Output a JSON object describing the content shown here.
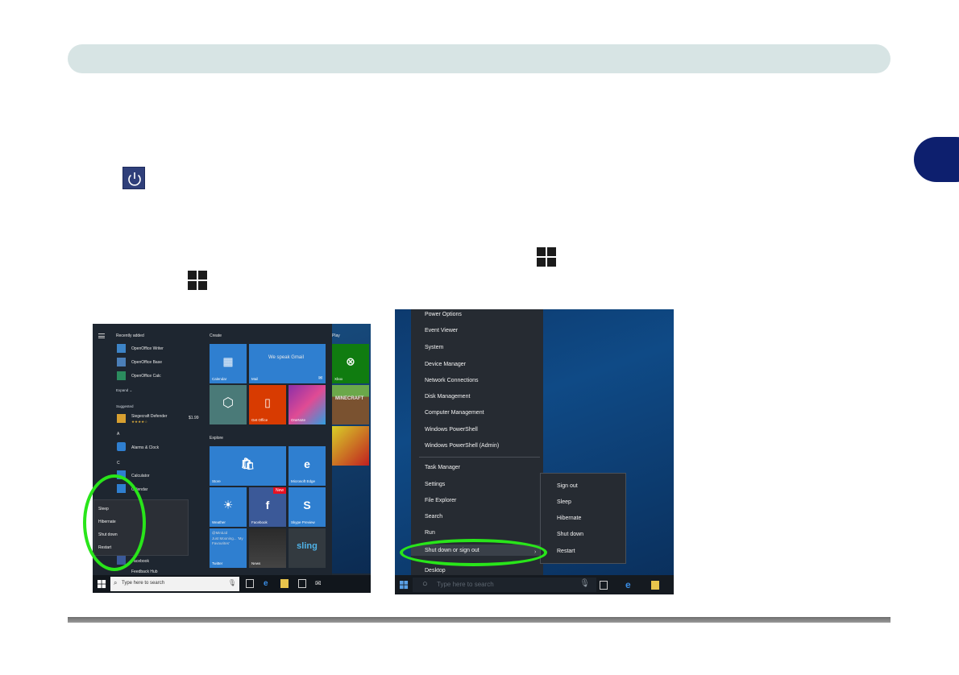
{
  "start_menu": {
    "recently_added_heading": "Recently added",
    "recent_apps": [
      "OpenOffice Writer",
      "OpenOffice Base",
      "OpenOffice Calc"
    ],
    "expand_label": "Expand",
    "suggested_heading": "Suggested",
    "suggested_app": "Siegecraft Defender",
    "suggested_price": "$1.99",
    "letter_a": "A",
    "alarms_app": "Alarms & Clock",
    "letter_c": "C",
    "calculator_app": "Calculator",
    "calendar_app": "Calendar",
    "facebook_app": "Facebook",
    "feedback_app": "Feedback Hub",
    "create_heading": "Create",
    "play_heading": "Play",
    "explore_heading": "Explore",
    "tiles": {
      "calendar": "Calendar",
      "mail_message": "We speak Gmail",
      "mail": "Mail",
      "xbox": "Xbox",
      "get_office": "Get Office",
      "onenote": "OneNote",
      "minecraft": "MINECRAFT",
      "solitaire": "Solitaire Collection",
      "fallout": "Fallout Sh...",
      "store": "Store",
      "edge": "Microsoft Edge",
      "weather": "Weather",
      "facebook": "Facebook",
      "new_badge": "New",
      "skype": "Skype Preview",
      "twitter_handle": "@MiniLtd",
      "twitter_text": "Just Mooning... 'My Favourites'",
      "twitter": "Twitter",
      "news": "News",
      "sling": "sling"
    },
    "power_options": [
      "Sleep",
      "Hibernate",
      "Shut down",
      "Restart"
    ],
    "search_placeholder": "Type here to search",
    "colors": {
      "accent": "#2f7fd0",
      "highlight": "#29e51a"
    }
  },
  "winx_menu": {
    "items_top": [
      "Power Options",
      "Event Viewer",
      "System",
      "Device Manager",
      "Network Connections",
      "Disk Management",
      "Computer Management",
      "Windows PowerShell",
      "Windows PowerShell (Admin)"
    ],
    "items_bottom": [
      "Task Manager",
      "Settings",
      "File Explorer",
      "Search",
      "Run",
      "Shut down or sign out",
      "Desktop"
    ],
    "submenu": [
      "Sign out",
      "Sleep",
      "Hibernate",
      "Shut down",
      "Restart"
    ],
    "search_placeholder": "Type here to search"
  }
}
